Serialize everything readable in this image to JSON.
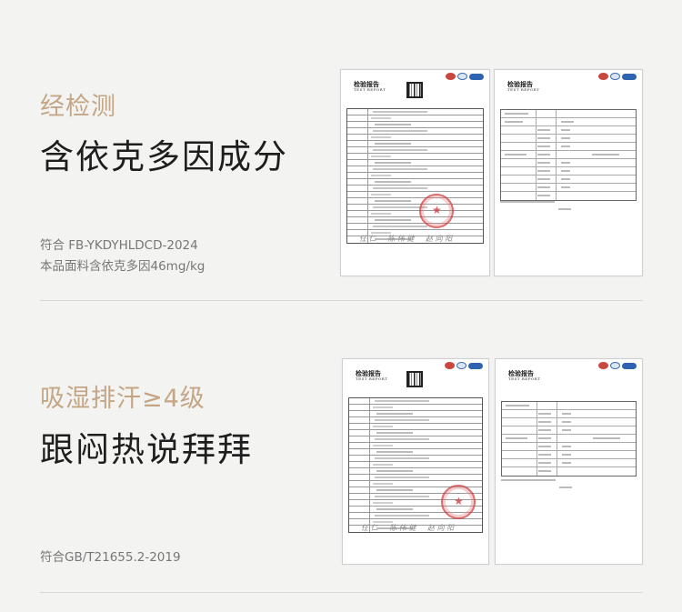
{
  "section1": {
    "subtitle": "经检测",
    "headline": "含依克多因成分",
    "note_line1": "符合 FB-YKDYHLDCD-2024",
    "note_line2": "本品面料含依克多因46mg/kg"
  },
  "section2": {
    "subtitle": "吸湿排汗≥4级",
    "headline": "跟闷热说拜拜",
    "note_line1": "符合GB/T21655.2-2019"
  },
  "report": {
    "title": "检验报告",
    "subtitle": "TEST REPORT"
  },
  "colors": {
    "accent": "#c4a584",
    "background": "#f3f3f2",
    "stamp": "#cd3c3c"
  }
}
